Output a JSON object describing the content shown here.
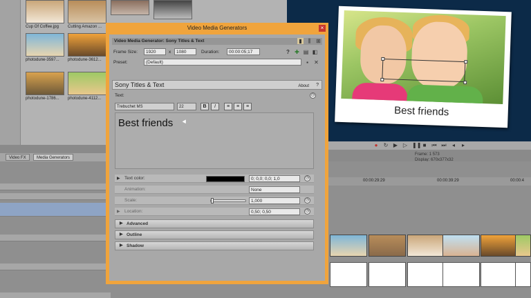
{
  "media": {
    "items": [
      {
        "label": "Cup Of Coffee.jpg"
      },
      {
        "label": "Cutting Amazon ..."
      },
      {
        "label": "photodune-3597..."
      },
      {
        "label": "photodune-3612..."
      },
      {
        "label": "photodune-1786..."
      },
      {
        "label": "photodune-4112..."
      }
    ]
  },
  "tabs": {
    "video_fx": "Video FX",
    "media_generators": "Media Generators"
  },
  "preview": {
    "caption": "Best friends",
    "frame_label": "Frame:",
    "frame_value": "1 573",
    "display_label": "Display:",
    "display_value": "670x377x32"
  },
  "ruler": {
    "ticks": [
      "00:00:29:29",
      "00:00:39:29",
      "00:00:4"
    ]
  },
  "dialog": {
    "title": "Video Media Generators",
    "close": "×",
    "header": "Video Media Generator:  Sony Titles & Text",
    "frame_size_label": "Frame Size:",
    "frame_w": "1920",
    "frame_x": "x",
    "frame_h": "1080",
    "duration_label": "Duration:",
    "duration": "00:00:05;17",
    "preset_label": "Preset:",
    "preset": "(Default)",
    "plugin_name": "Sony Titles & Text",
    "about": "About",
    "help": "?",
    "text_label": "Text:",
    "font": "Trebuchet MS",
    "font_size": "22",
    "bold": "B",
    "italic": "I",
    "text_value": "Best friends",
    "props": {
      "text_color_label": "Text color:",
      "text_color_value": "0; 0,0; 0,0; 1,0",
      "animation_label": "Animation:",
      "animation_value": "None",
      "scale_label": "Scale:",
      "scale_value": "1,000",
      "location_label": "Location:",
      "location_value": "0,50; 0,50"
    },
    "sections": {
      "advanced": "Advanced",
      "outline": "Outline",
      "shadow": "Shadow"
    }
  }
}
